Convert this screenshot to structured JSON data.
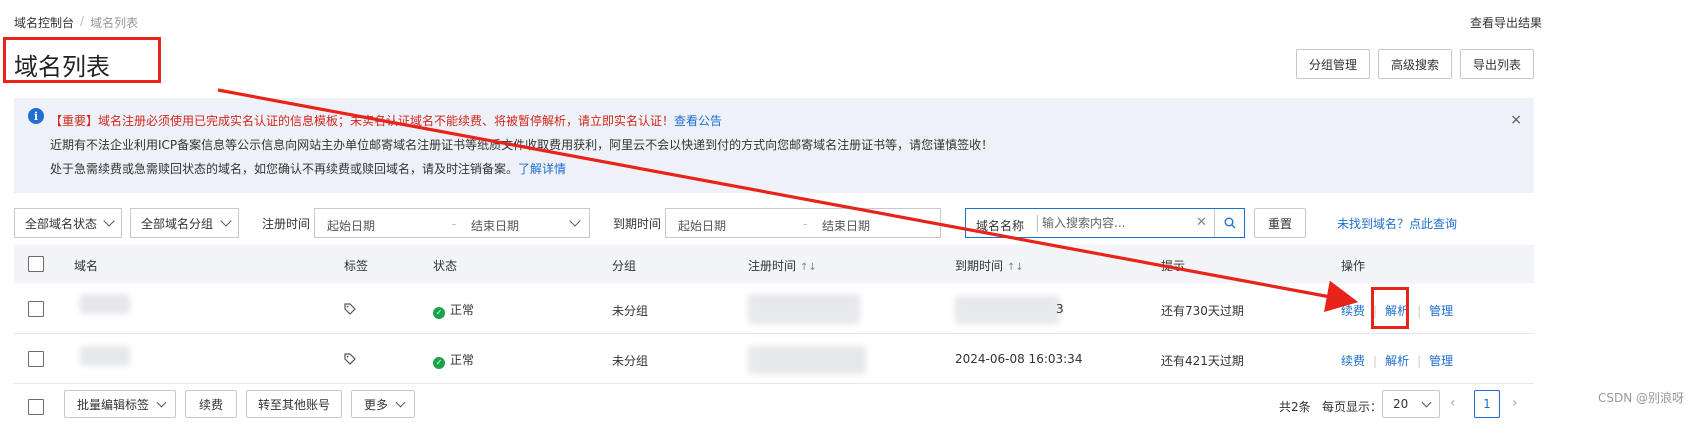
{
  "breadcrumb": {
    "home": "域名控制台",
    "sep": "/",
    "current": "域名列表"
  },
  "top_link": "查看导出结果",
  "page_title": "域名列表",
  "header_buttons": {
    "group": "分组管理",
    "advanced": "高级搜索",
    "export": "导出列表"
  },
  "notice": {
    "line1_text": "【重要】域名注册必须使用已完成实名认证的信息模板；未实名认证域名不能续费、将被暂停解析，请立即实名认证！",
    "line1_link": "查看公告",
    "line2": "近期有不法企业利用ICP备案信息等公示信息向网站主办单位邮寄域名注册证书等纸质文件收取费用获利，阿里云不会以快递到付的方式向您邮寄域名注册证书等，请您谨慎签收！",
    "line3_text": "处于急需续费或急需赎回状态的域名，如您确认不再续费或赎回域名，请及时注销备案。",
    "line3_link": "了解详情",
    "close": "×"
  },
  "filters": {
    "status": "全部域名状态",
    "group": "全部域名分组",
    "reg_label": "注册时间",
    "reg_start": "起始日期",
    "reg_end": "结束日期",
    "exp_label": "到期时间",
    "exp_start": "起始日期",
    "exp_end": "结束日期",
    "search_kind": "域名名称",
    "search_placeholder": "输入搜索内容...",
    "reset": "重置",
    "not_found": "未找到域名？点此查询"
  },
  "table": {
    "headers": {
      "domain": "域名",
      "tags": "标签",
      "status": "状态",
      "group": "分组",
      "reg_time": "注册时间",
      "exp_time": "到期时间",
      "hint": "提示",
      "ops": "操作"
    },
    "sort_glyph": "↑↓",
    "rows": [
      {
        "status": "正常",
        "group": "未分组",
        "exp_time_visible": "3",
        "hint": "还有730天过期",
        "ops": [
          "续费",
          "解析",
          "管理"
        ]
      },
      {
        "status": "正常",
        "group": "未分组",
        "exp_time_visible": "2024-06-08 16:03:34",
        "hint": "还有421天过期",
        "ops": [
          "续费",
          "解析",
          "管理"
        ]
      }
    ]
  },
  "footer": {
    "batch_tags": "批量编辑标签",
    "renew": "续费",
    "transfer": "转至其他账号",
    "more": "更多",
    "total": "共2条",
    "per_page_label": "每页显示：",
    "per_page": "20",
    "page": "1"
  },
  "watermark": "CSDN @别浪呀",
  "colors": {
    "accent": "#1e6fd1",
    "annotation": "#e8231a",
    "ok": "#1aa34a",
    "warning_text": "#d0281d"
  }
}
